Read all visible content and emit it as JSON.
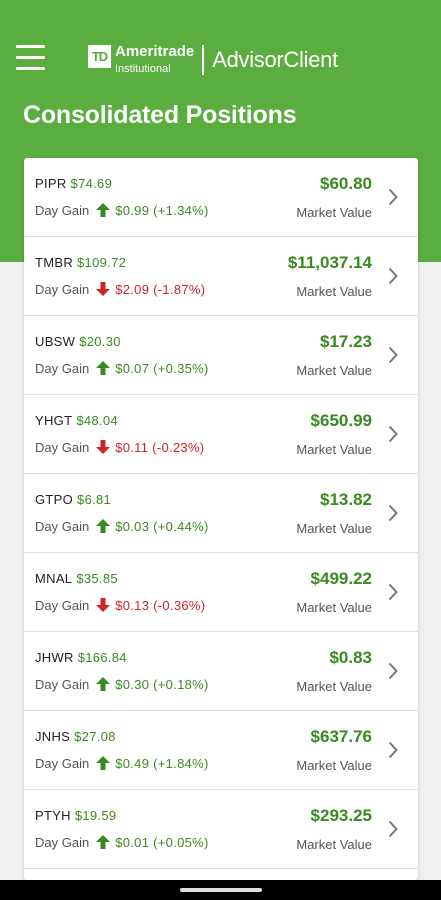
{
  "app": {
    "logo_initials": "TD",
    "brand": "Ameritrade",
    "brand_sub": "Institutional",
    "product": "AdvisorClient"
  },
  "page": {
    "title": "Consolidated Positions"
  },
  "labels": {
    "day_gain": "Day Gain",
    "market_value": "Market Value"
  },
  "colors": {
    "header_green": "#5aae3f",
    "gain_green": "#3a8a22",
    "loss_red": "#d02424"
  },
  "positions": [
    {
      "symbol": "PIPR",
      "price": "$74.69",
      "change": "$0.99 (+1.34%)",
      "direction": "up",
      "market_value": "$60.80"
    },
    {
      "symbol": "TMBR",
      "price": "$109.72",
      "change": "$2.09 (-1.87%)",
      "direction": "down",
      "market_value": "$11,037.14"
    },
    {
      "symbol": "UBSW",
      "price": "$20.30",
      "change": "$0.07 (+0.35%)",
      "direction": "up",
      "market_value": "$17.23"
    },
    {
      "symbol": "YHGT",
      "price": "$48.04",
      "change": "$0.11 (-0.23%)",
      "direction": "down",
      "market_value": "$650.99"
    },
    {
      "symbol": "GTPO",
      "price": "$6.81",
      "change": "$0.03 (+0.44%)",
      "direction": "up",
      "market_value": "$13.82"
    },
    {
      "symbol": "MNAL",
      "price": "$35.85",
      "change": "$0.13 (-0.36%)",
      "direction": "down",
      "market_value": "$499.22"
    },
    {
      "symbol": "JHWR",
      "price": "$166.84",
      "change": "$0.30 (+0.18%)",
      "direction": "up",
      "market_value": "$0.83"
    },
    {
      "symbol": "JNHS",
      "price": "$27.08",
      "change": "$0.49 (+1.84%)",
      "direction": "up",
      "market_value": "$637.76"
    },
    {
      "symbol": "PTYH",
      "price": "$19.59",
      "change": "$0.01 (+0.05%)",
      "direction": "up",
      "market_value": "$293.25"
    }
  ]
}
